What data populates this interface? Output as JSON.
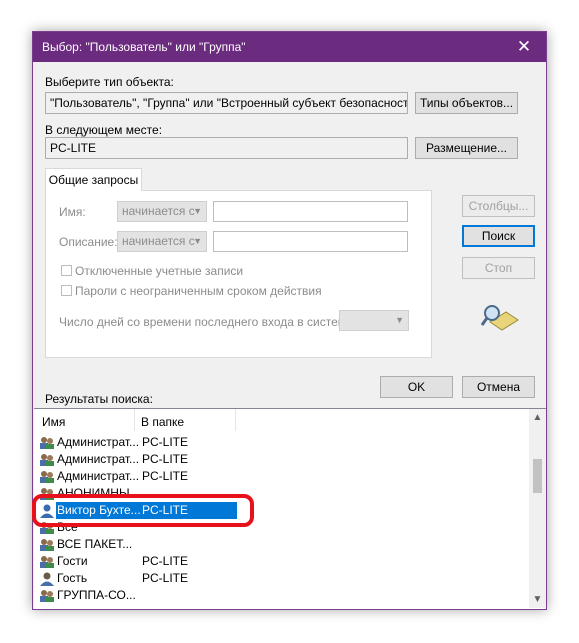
{
  "window": {
    "title": "Выбор: \"Пользователь\" или \"Группа\""
  },
  "object_type": {
    "label": "Выберите тип объекта:",
    "value": "\"Пользователь\", \"Группа\" или \"Встроенный субъект безопасности\"",
    "button": "Типы объектов..."
  },
  "location": {
    "label": "В следующем месте:",
    "value": "PC-LITE",
    "button": "Размещение..."
  },
  "tab": {
    "label": "Общие запросы"
  },
  "query": {
    "name_label": "Имя:",
    "name_combo": "начинается с",
    "desc_label": "Описание:",
    "desc_combo": "начинается с",
    "disabled_accounts": "Отключенные учетные записи",
    "non_expiring": "Пароли с неограниченным сроком действия",
    "days_label": "Число дней со времени последнего входа в систему:"
  },
  "buttons": {
    "columns": "Столбцы...",
    "search": "Поиск",
    "stop": "Стоп",
    "ok": "OK",
    "cancel": "Отмена"
  },
  "results": {
    "label": "Результаты поиска:",
    "columns": [
      "Имя",
      "В папке"
    ],
    "rows": [
      {
        "name": "Администрат...",
        "folder": "PC-LITE",
        "icon": "group-icon"
      },
      {
        "name": "Администрат...",
        "folder": "PC-LITE",
        "icon": "group-icon"
      },
      {
        "name": "Администрат...",
        "folder": "PC-LITE",
        "icon": "group-icon"
      },
      {
        "name": "АНОНИМНЫ...",
        "folder": "",
        "icon": "group-icon"
      },
      {
        "name": "Виктор Бухте...",
        "folder": "PC-LITE",
        "icon": "user-icon",
        "selected": true
      },
      {
        "name": "Все",
        "folder": "",
        "icon": "group-icon"
      },
      {
        "name": "ВСЕ ПАКЕТ...",
        "folder": "",
        "icon": "group-icon"
      },
      {
        "name": "Гости",
        "folder": "PC-LITE",
        "icon": "group-icon"
      },
      {
        "name": "Гость",
        "folder": "PC-LITE",
        "icon": "user-icon"
      },
      {
        "name": "ГРУППА-СО...",
        "folder": "",
        "icon": "group-icon"
      }
    ]
  },
  "colors": {
    "titlebar": "#6b2b7e",
    "selection": "#0078d7",
    "highlight": "#e8101a"
  }
}
